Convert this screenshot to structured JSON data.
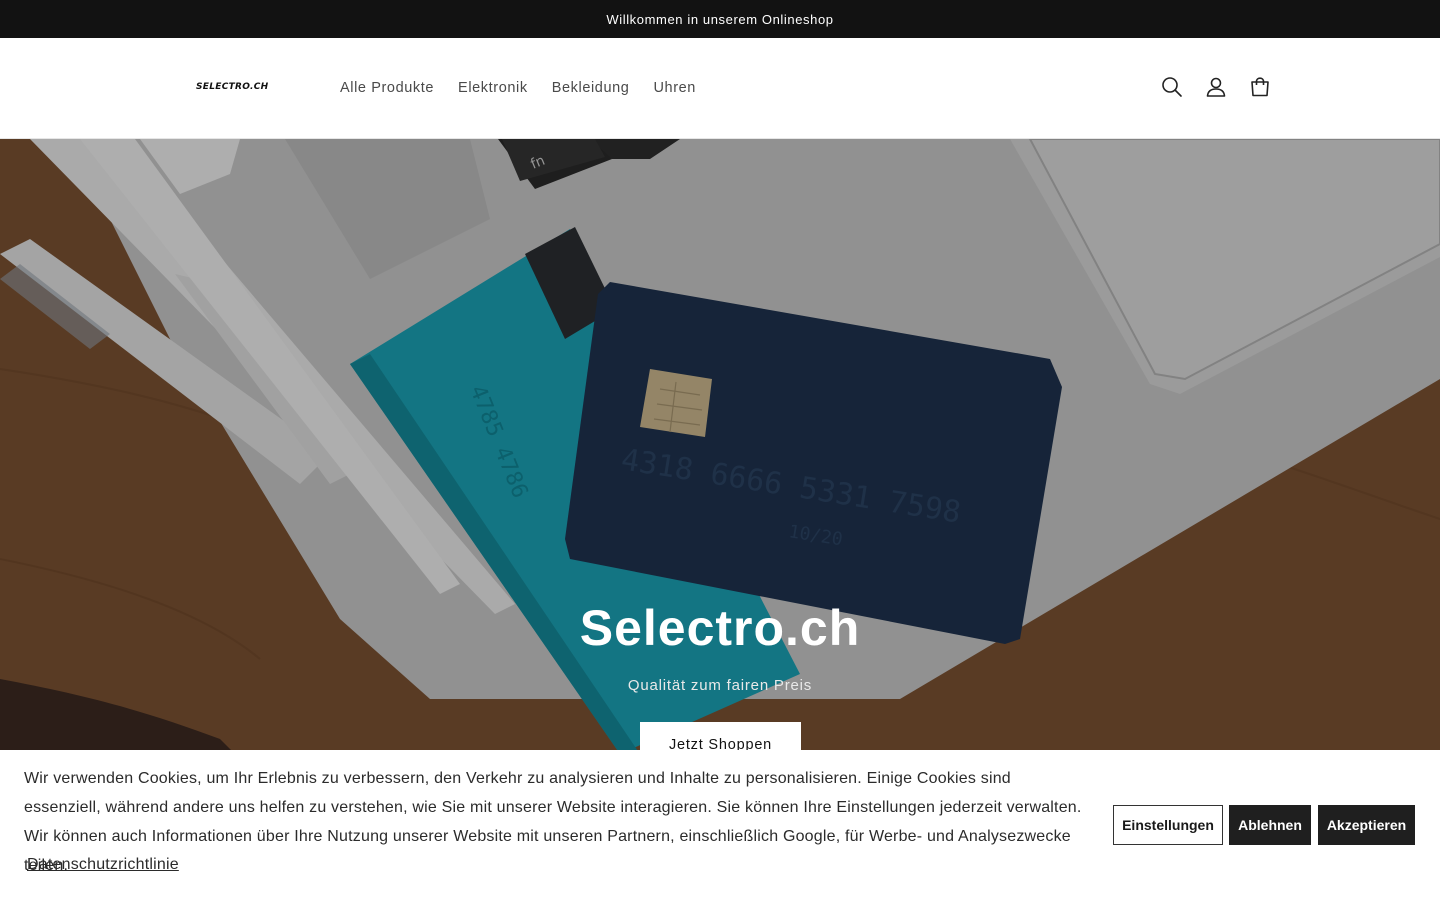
{
  "announcement": {
    "text": "Willkommen in unserem Onlineshop"
  },
  "header": {
    "logo_text": "SELECTRO.CH",
    "nav": [
      {
        "label": "Alle Produkte"
      },
      {
        "label": "Elektronik"
      },
      {
        "label": "Bekleidung"
      },
      {
        "label": "Uhren"
      }
    ],
    "icons": [
      "search-icon",
      "account-icon",
      "cart-icon"
    ]
  },
  "hero": {
    "title": "Selectro.ch",
    "subtitle": "Qualität zum fairen Preis",
    "button_label": "Jetzt Shoppen",
    "image_texts": {
      "key_fn": "fn",
      "card_number": "4318 6666 5331 7598",
      "card_expiry": "10/20"
    }
  },
  "cookie_banner": {
    "text": "Wir verwenden Cookies, um Ihr Erlebnis zu verbessern, den Verkehr zu analysieren und Inhalte zu personalisieren. Einige Cookies sind essenziell, während andere uns helfen zu verstehen, wie Sie mit unserer Website interagieren. Sie können Ihre Einstellungen jederzeit verwalten. Wir können auch Informationen über Ihre Nutzung unserer Website mit unseren Partnern, einschließlich Google, für Werbe- und Analysezwecke teilen.",
    "privacy_link": "Datenschutzrichtlinie",
    "settings_label": "Einstellungen",
    "decline_label": "Ablehnen",
    "accept_label": "Akzeptieren"
  },
  "colors": {
    "announcement_bg": "#121212",
    "button_dark": "#1f1f1f",
    "card_navy": "#1f3350",
    "card_teal": "#1ba3b6",
    "desk_wood": "#7c5232"
  }
}
